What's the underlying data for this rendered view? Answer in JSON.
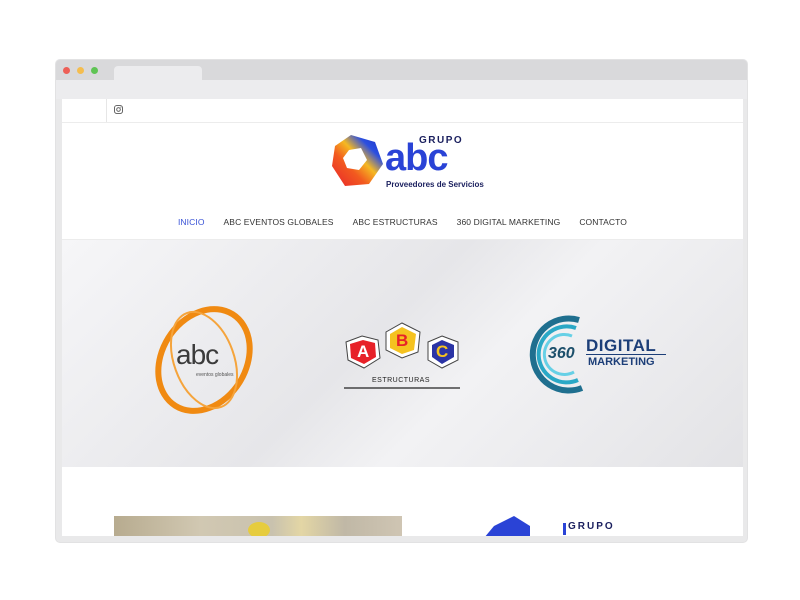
{
  "topbar": {
    "icon": "instagram-icon"
  },
  "logo": {
    "grupo": "GRUPO",
    "abc": "abc",
    "tagline": "Proveedores de Servicios"
  },
  "nav": {
    "items": [
      {
        "label": "INICIO",
        "active": true
      },
      {
        "label": "ABC EVENTOS GLOBALES",
        "active": false
      },
      {
        "label": "ABC ESTRUCTURAS",
        "active": false
      },
      {
        "label": "360 DIGITAL MARKETING",
        "active": false
      },
      {
        "label": "CONTACTO",
        "active": false
      }
    ]
  },
  "hero": {
    "eventos": {
      "name": "abc",
      "sub": "eventos globales"
    },
    "estructuras": {
      "letters": [
        "A",
        "B",
        "C"
      ],
      "name": "ESTRUCTURAS"
    },
    "digital": {
      "num": "360",
      "word1": "DIGITAL",
      "word2": "MARKETING"
    }
  },
  "lower": {
    "grupo": "GRUPO"
  },
  "colors": {
    "accent": "#3953d6",
    "brand_blue": "#2a43d6",
    "orange": "#f08a12"
  }
}
